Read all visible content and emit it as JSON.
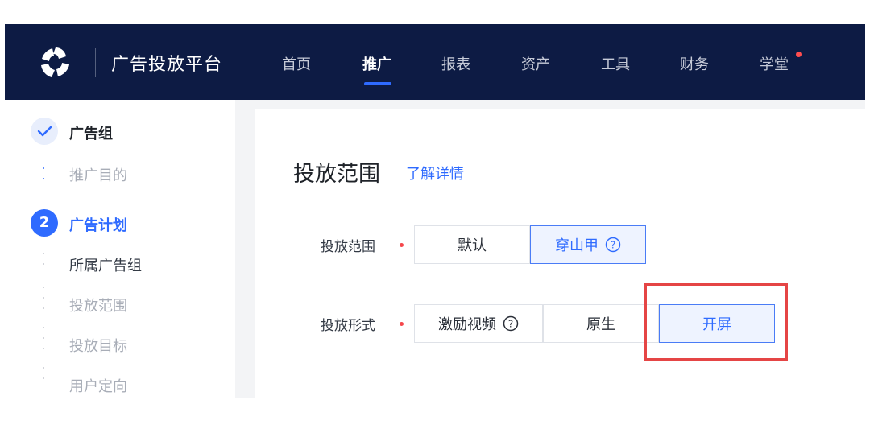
{
  "header": {
    "app_title": "广告投放平台",
    "nav": [
      {
        "label": "首页",
        "active": false
      },
      {
        "label": "推广",
        "active": true
      },
      {
        "label": "报表",
        "active": false
      },
      {
        "label": "资产",
        "active": false
      },
      {
        "label": "工具",
        "active": false
      },
      {
        "label": "财务",
        "active": false
      },
      {
        "label": "学堂",
        "active": false,
        "has_notification_dot": true
      }
    ],
    "colors": {
      "background": "#0d1b44",
      "accent": "#2f6bff",
      "notification": "#ff4d4f"
    }
  },
  "sidebar": {
    "steps": [
      {
        "icon": "check-icon",
        "label": "广告组",
        "state": "done",
        "children": [
          {
            "label": "推广目的"
          }
        ]
      },
      {
        "number": "2",
        "label": "广告计划",
        "state": "current",
        "children": [
          {
            "label": "所属广告组",
            "current": true
          },
          {
            "label": "投放范围"
          },
          {
            "label": "投放目标"
          },
          {
            "label": "用户定向"
          }
        ]
      }
    ]
  },
  "main": {
    "section_title": "投放范围",
    "learn_more": "了解详情",
    "fields": [
      {
        "label": "投放范围",
        "required": true,
        "options": [
          {
            "label": "默认",
            "selected": false,
            "help": false
          },
          {
            "label": "穿山甲",
            "selected": true,
            "help": true
          }
        ]
      },
      {
        "label": "投放形式",
        "required": true,
        "options": [
          {
            "label": "激励视频",
            "selected": false,
            "help": true
          },
          {
            "label": "原生",
            "selected": false,
            "help": false
          },
          {
            "label": "开屏",
            "selected": true,
            "help": false,
            "highlighted": true
          }
        ]
      }
    ],
    "colors": {
      "selected_border": "#4a7cf6",
      "selected_bg": "#eef3ff",
      "required": "#f5474b",
      "annotation": "#e54545"
    }
  }
}
